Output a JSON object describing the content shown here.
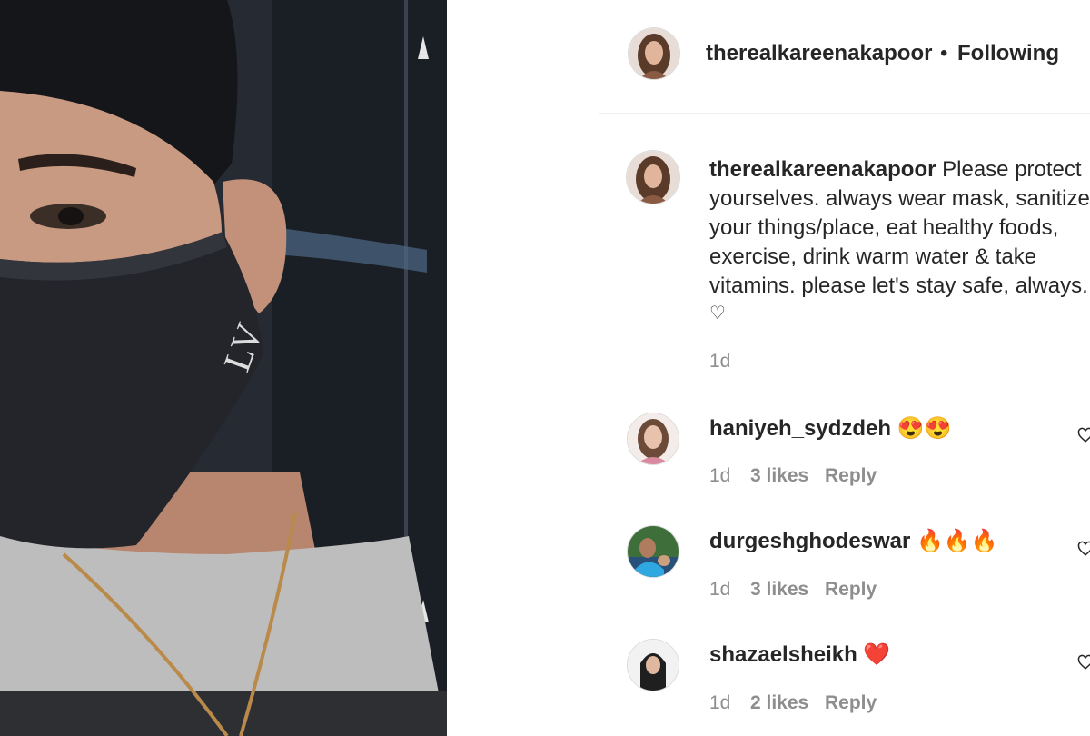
{
  "post": {
    "header": {
      "username": "therealkareenakapoor",
      "separator": "•",
      "follow_status": "Following"
    },
    "caption": {
      "username": "therealkareenakapoor",
      "lines": [
        "Please protect",
        "yourselves. always wear mask, sanitize",
        "your things/place, eat healthy foods,",
        "exercise, drink warm water & take",
        "vitamins. please let's stay safe, always."
      ],
      "heart": "♡",
      "time": "1d"
    },
    "comments": [
      {
        "username": "haniyeh_sydzdeh",
        "text": "😍😍",
        "time": "1d",
        "likes": "3 likes",
        "reply": "Reply"
      },
      {
        "username": "durgeshghodeswar",
        "text": "🔥🔥🔥",
        "time": "1d",
        "likes": "3 likes",
        "reply": "Reply"
      },
      {
        "username": "shazaelsheikh",
        "text": "❤️",
        "time": "1d",
        "likes": "2 likes",
        "reply": "Reply"
      }
    ]
  },
  "colors": {
    "text": "#262626",
    "muted": "#8e8e8e",
    "border": "#efefef"
  }
}
